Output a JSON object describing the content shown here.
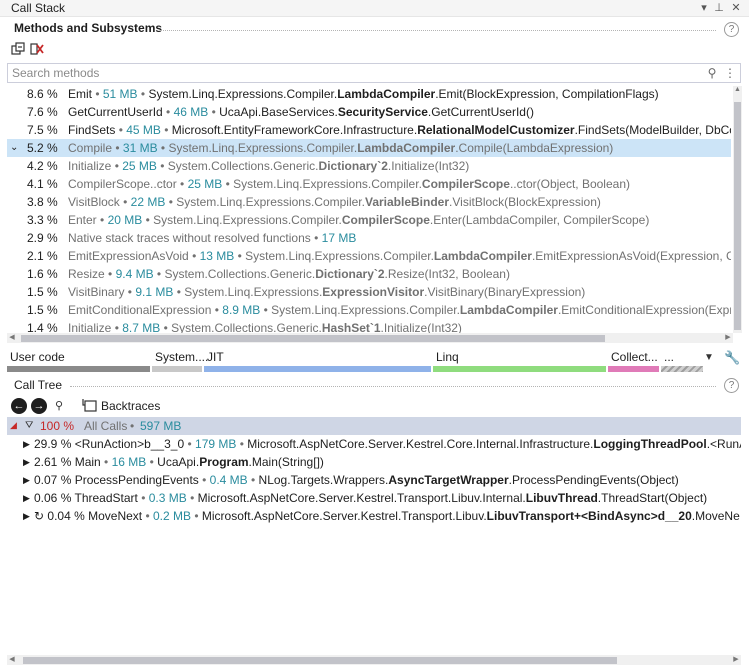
{
  "window": {
    "title": "Call Stack"
  },
  "methods_panel": {
    "title": "Methods and Subsystems",
    "search_placeholder": "Search methods",
    "rows": [
      {
        "pct": "8.6 %",
        "name": "Emit",
        "size": "51 MB",
        "ns": "System.Linq.Expressions.Compiler.",
        "cls": "LambdaCompiler",
        "rest": ".Emit(BlockExpression, CompilationFlags)",
        "muted": false
      },
      {
        "pct": "7.6 %",
        "name": "GetCurrentUserId",
        "size": "46 MB",
        "ns": "UcaApi.BaseServices.",
        "cls": "SecurityService",
        "rest": ".GetCurrentUserId()",
        "muted": false
      },
      {
        "pct": "7.5 %",
        "name": "FindSets",
        "size": "45 MB",
        "ns": "Microsoft.EntityFrameworkCore.Infrastructure.",
        "cls": "RelationalModelCustomizer",
        "rest": ".FindSets(ModelBuilder, DbCo",
        "muted": false
      },
      {
        "pct": "5.2 %",
        "name": "Compile",
        "size": "31 MB",
        "ns": "System.Linq.Expressions.Compiler.",
        "cls": "LambdaCompiler",
        "rest": ".Compile(LambdaExpression)",
        "muted": true
      },
      {
        "pct": "4.2 %",
        "name": "Initialize",
        "size": "25 MB",
        "ns": "System.Collections.Generic.",
        "cls": "Dictionary`2",
        "rest": ".Initialize(Int32)",
        "muted": true
      },
      {
        "pct": "4.1 %",
        "name": "CompilerScope..ctor",
        "size": "25 MB",
        "ns": "System.Linq.Expressions.Compiler.",
        "cls": "CompilerScope",
        "rest": "..ctor(Object, Boolean)",
        "muted": true
      },
      {
        "pct": "3.8 %",
        "name": "VisitBlock",
        "size": "22 MB",
        "ns": "System.Linq.Expressions.Compiler.",
        "cls": "VariableBinder",
        "rest": ".VisitBlock(BlockExpression)",
        "muted": true
      },
      {
        "pct": "3.3 %",
        "name": "Enter",
        "size": "20 MB",
        "ns": "System.Linq.Expressions.Compiler.",
        "cls": "CompilerScope",
        "rest": ".Enter(LambdaCompiler, CompilerScope)",
        "muted": true
      },
      {
        "pct": "2.9 %",
        "name": "Native stack traces without resolved functions",
        "size": "17 MB",
        "ns": "",
        "cls": "",
        "rest": "",
        "muted": true
      },
      {
        "pct": "2.1 %",
        "name": "EmitExpressionAsVoid",
        "size": "13 MB",
        "ns": "System.Linq.Expressions.Compiler.",
        "cls": "LambdaCompiler",
        "rest": ".EmitExpressionAsVoid(Expression, Con",
        "muted": true
      },
      {
        "pct": "1.6 %",
        "name": "Resize",
        "size": "9.4 MB",
        "ns": "System.Collections.Generic.",
        "cls": "Dictionary`2",
        "rest": ".Resize(Int32, Boolean)",
        "muted": true
      },
      {
        "pct": "1.5 %",
        "name": "VisitBinary",
        "size": "9.1 MB",
        "ns": "System.Linq.Expressions.",
        "cls": "ExpressionVisitor",
        "rest": ".VisitBinary(BinaryExpression)",
        "muted": true
      },
      {
        "pct": "1.5 %",
        "name": "EmitConditionalExpression",
        "size": "8.9 MB",
        "ns": "System.Linq.Expressions.Compiler.",
        "cls": "LambdaCompiler",
        "rest": ".EmitConditionalExpression(Expres",
        "muted": true
      },
      {
        "pct": "1.4 %",
        "name": "Initialize",
        "size": "8.7 MB",
        "ns": "System.Collections.Generic.",
        "cls": "HashSet`1",
        "rest": ".Initialize(Int32)",
        "muted": true
      }
    ],
    "selected_index": 3
  },
  "subsystems": [
    {
      "label": "User code",
      "color": "#8a8a8a"
    },
    {
      "label": "System....",
      "color": "#c8c8c8"
    },
    {
      "label": "JIT",
      "color": "#8fb2e9"
    },
    {
      "label": "Linq",
      "color": "#8fdc7e"
    },
    {
      "label": "Collect...",
      "color": "#e07bb8"
    },
    {
      "label": "...",
      "color": "#bdbdbd"
    }
  ],
  "call_tree": {
    "title": "Call Tree",
    "backtraces_label": "Backtraces",
    "all_calls": {
      "pct": "100 %",
      "label": "All Calls",
      "size": "597 MB"
    },
    "rows": [
      {
        "pct": "29.9 %",
        "name": "<RunAction>b__3_0",
        "size": "179 MB",
        "ns": "Microsoft.AspNetCore.Server.Kestrel.Core.Internal.Infrastructure.",
        "cls": "LoggingThreadPool",
        "rest": ".<RunA",
        "recursive": false
      },
      {
        "pct": "2.61 %",
        "name": "Main",
        "size": "16 MB",
        "ns": "UcaApi.",
        "cls": "Program",
        "rest": ".Main(String[])",
        "recursive": false
      },
      {
        "pct": "0.07 %",
        "name": "ProcessPendingEvents",
        "size": "0.4 MB",
        "ns": "NLog.Targets.Wrappers.",
        "cls": "AsyncTargetWrapper",
        "rest": ".ProcessPendingEvents(Object)",
        "recursive": false
      },
      {
        "pct": "0.06 %",
        "name": "ThreadStart",
        "size": "0.3 MB",
        "ns": "Microsoft.AspNetCore.Server.Kestrel.Transport.Libuv.Internal.",
        "cls": "LibuvThread",
        "rest": ".ThreadStart(Object)",
        "recursive": false
      },
      {
        "pct": "0.04 %",
        "name": "MoveNext",
        "size": "0.2 MB",
        "ns": "Microsoft.AspNetCore.Server.Kestrel.Transport.Libuv.",
        "cls": "LibuvTransport+<BindAsync>d__20",
        "rest": ".MoveNe",
        "recursive": true
      }
    ]
  },
  "icons": {
    "help": "?",
    "pin": "pin-icon",
    "close": "close-icon",
    "dropdown": "chevron-down-icon",
    "settings": "wrench-icon"
  }
}
